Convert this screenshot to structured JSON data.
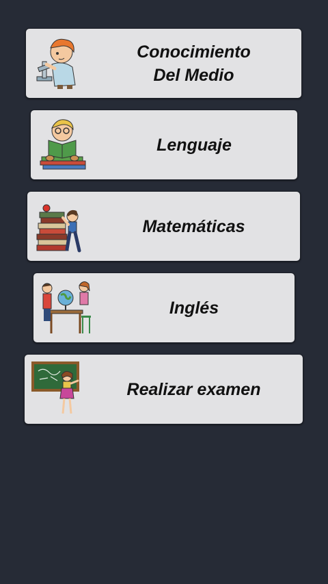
{
  "menu": {
    "items": [
      {
        "label": "Conocimiento\nDel Medio",
        "icon": "scientist-kid-microscope-icon"
      },
      {
        "label": "Lenguaje",
        "icon": "kid-reading-book-icon"
      },
      {
        "label": "Matemáticas",
        "icon": "kid-stacked-books-icon"
      },
      {
        "label": "Inglés",
        "icon": "kids-globe-desk-icon"
      },
      {
        "label": "Realizar examen",
        "icon": "teacher-chalkboard-icon"
      }
    ]
  },
  "colors": {
    "background": "#262b36",
    "card": "#e2e2e4",
    "text": "#111111"
  }
}
